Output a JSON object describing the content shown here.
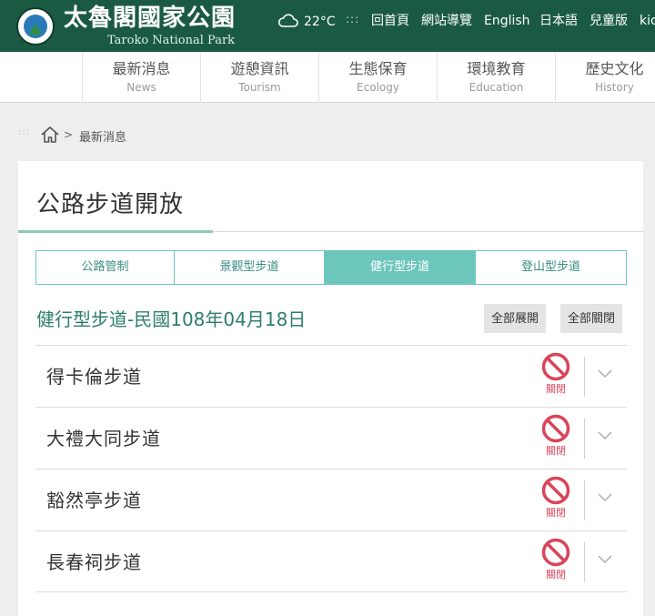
{
  "header": {
    "logo_cn": "太魯閣國家公園",
    "logo_en": "Taroko National Park",
    "temperature": "22°C",
    "dots": ":::",
    "links": [
      "回首頁",
      "網站導覽",
      "English",
      "日本語",
      "兒童版",
      "kic"
    ]
  },
  "nav": [
    {
      "cn": "最新消息",
      "en": "News"
    },
    {
      "cn": "遊憩資訊",
      "en": "Tourism"
    },
    {
      "cn": "生態保育",
      "en": "Ecology"
    },
    {
      "cn": "環境教育",
      "en": "Education"
    },
    {
      "cn": "歷史文化",
      "en": "History"
    }
  ],
  "breadcrumb": {
    "dots": ":::",
    "arrow": ">",
    "current": "最新消息"
  },
  "page_title": "公路步道開放",
  "tabs": [
    {
      "label": "公路管制",
      "active": false
    },
    {
      "label": "景觀型步道",
      "active": false
    },
    {
      "label": "健行型步道",
      "active": true
    },
    {
      "label": "登山型步道",
      "active": false
    }
  ],
  "section_title": "健行型步道-民國108年04月18日",
  "expand_all": "全部展開",
  "collapse_all": "全部關閉",
  "trails": [
    {
      "name": "得卡倫步道",
      "status": "關閉"
    },
    {
      "name": "大禮大同步道",
      "status": "關閉"
    },
    {
      "name": "豁然亭步道",
      "status": "關閉"
    },
    {
      "name": "長春祠步道",
      "status": "關閉"
    }
  ],
  "colors": {
    "header_green": "#1a5a42",
    "teal_accent": "#6cc6bc",
    "title_green": "#2d7d6c",
    "closed_red": "#d9455a"
  },
  "icons": {
    "weather": "cloud-icon",
    "home": "home-icon",
    "status": "no-entry-icon",
    "expand": "chevron-down-icon"
  }
}
